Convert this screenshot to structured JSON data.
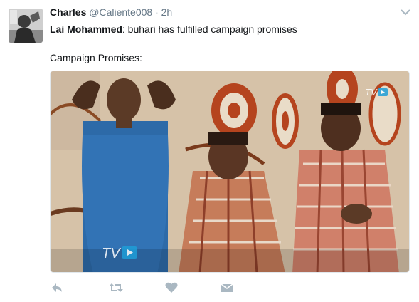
{
  "tweet": {
    "author_name": "Charles",
    "author_handle": "@Caliente008",
    "separator": "·",
    "time": "2h",
    "mention_name": "Lai Mohammed",
    "line1_rest": ": buhari has fulfilled campaign promises",
    "line2": "Campaign Promises:"
  },
  "media": {
    "watermark": "TV"
  },
  "icons": {
    "reply": "reply-icon",
    "retweet": "retweet-icon",
    "like": "heart-icon",
    "message": "envelope-icon",
    "more": "chevron-down-icon"
  },
  "colors": {
    "name": "#14171a",
    "secondary": "#657786",
    "icon": "#aab8c2"
  }
}
